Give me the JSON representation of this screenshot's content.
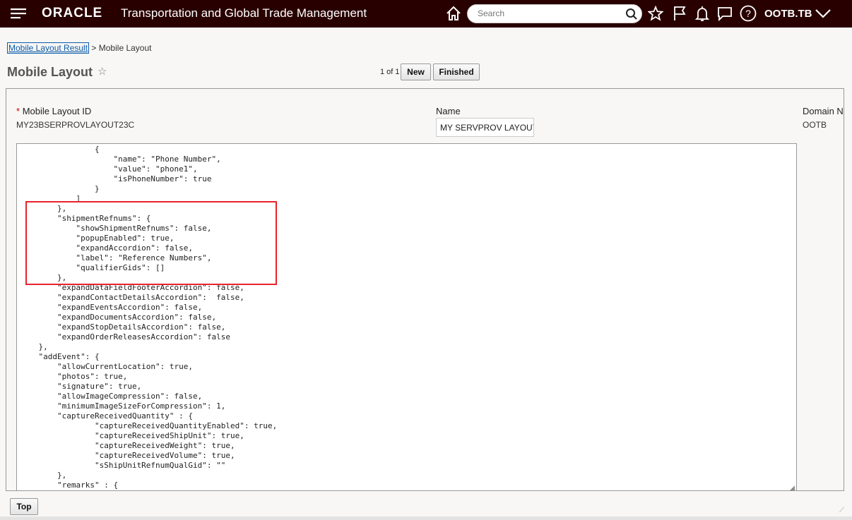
{
  "header": {
    "logo": "ORACLE",
    "title": "Transportation and Global Trade Management",
    "search_placeholder": "Search",
    "user": "OOTB.TB",
    "icons": [
      "menu-icon",
      "home-icon",
      "search-icon",
      "favorite-star-icon",
      "flag-icon",
      "bell-icon",
      "chat-icon",
      "help-icon",
      "chevron-down-icon"
    ]
  },
  "breadcrumb": {
    "link": "Mobile Layout Result",
    "separator": ">",
    "current": "Mobile Layout"
  },
  "page": {
    "title": "Mobile Layout",
    "pager": "1 of 1",
    "new_label": "New",
    "finished_label": "Finished",
    "top_label": "Top"
  },
  "form": {
    "id_label": "Mobile Layout ID",
    "id_required": "*",
    "id_value": "MY23BSERPROVLAYOUT23C",
    "name_label": "Name",
    "name_value": "MY SERVPROV LAYOUT",
    "domain_label": "Domain N",
    "domain_value": "OOTB"
  },
  "editor": {
    "highlight_color": "#e8222b",
    "lines": [
      "                {",
      "                    \"name\": \"Phone Number\",",
      "                    \"value\": \"phone1\",",
      "                    \"isPhoneNumber\": true",
      "                }",
      "            ]",
      "        },",
      "        \"shipmentRefnums\": {",
      "            \"showShipmentRefnums\": false,",
      "            \"popupEnabled\": true,",
      "            \"expandAccordion\": false,",
      "            \"label\": \"Reference Numbers\",",
      "            \"qualifierGids\": []",
      "        },",
      "        \"expandDataFieldFooterAccordion\": false,",
      "        \"expandContactDetailsAccordion\":  false,",
      "        \"expandEventsAccordion\": false,",
      "        \"expandDocumentsAccordion\": false,",
      "        \"expandStopDetailsAccordion\": false,",
      "        \"expandOrderReleasesAccordion\": false",
      "    },",
      "    \"addEvent\": {",
      "        \"allowCurrentLocation\": true,",
      "        \"photos\": true,",
      "        \"signature\": true,",
      "        \"allowImageCompression\": false,",
      "        \"minimumImageSizeForCompression\": 1,",
      "        \"captureReceivedQuantity\" : {",
      "                \"captureReceivedQuantityEnabled\": true,",
      "                \"captureReceivedShipUnit\": true,",
      "                \"captureReceivedWeight\": true,",
      "                \"captureReceivedVolume\": true,",
      "                \"sShipUnitRefnumQualGid\": \"\"",
      "        },",
      "        \"remarks\" : {"
    ]
  }
}
